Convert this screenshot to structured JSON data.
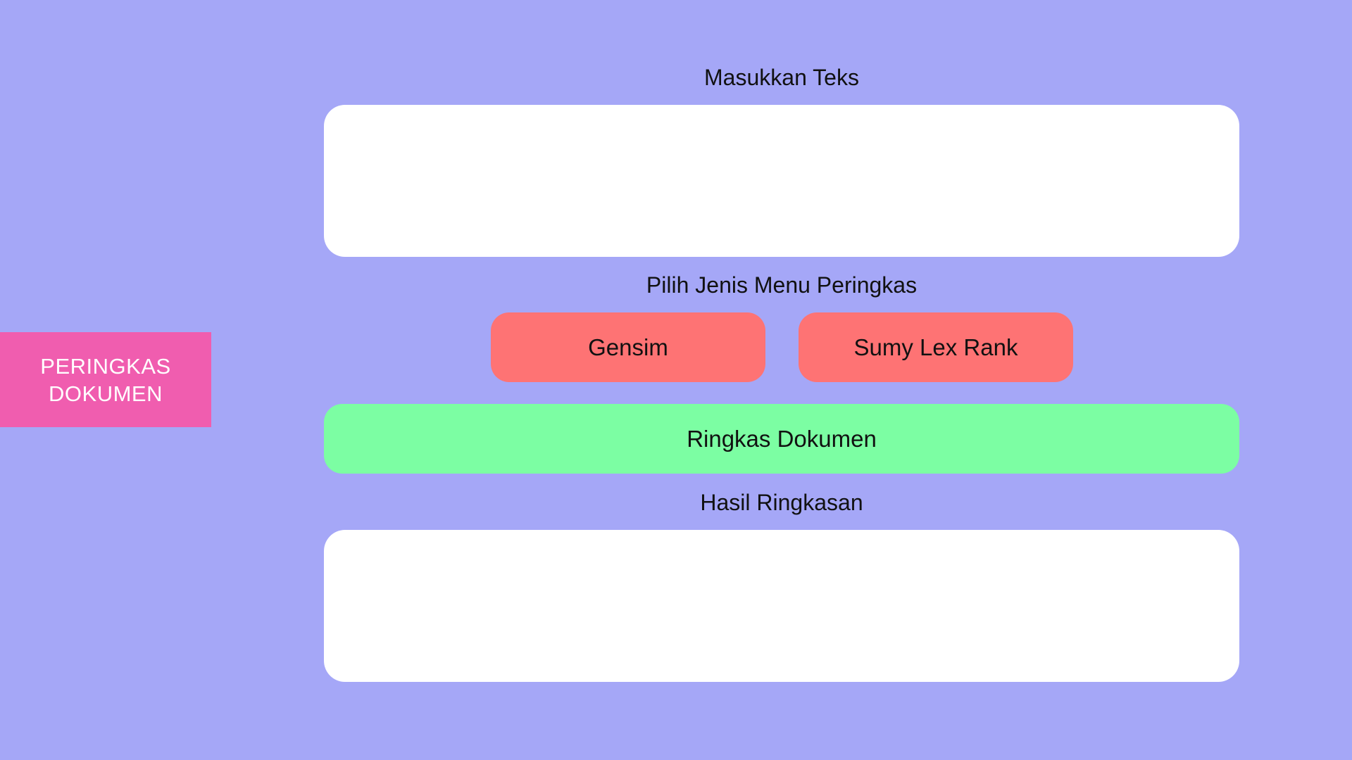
{
  "brand": {
    "line1": "PERINGKAS",
    "line2": "DOKUMEN"
  },
  "input_section": {
    "label": "Masukkan Teks",
    "value": ""
  },
  "method_section": {
    "label": "Pilih Jenis Menu Peringkas",
    "options": [
      {
        "label": "Gensim"
      },
      {
        "label": "Sumy Lex Rank"
      }
    ]
  },
  "actions": {
    "summarize_label": "Ringkas Dokumen"
  },
  "result_section": {
    "label": "Hasil Ringkasan",
    "value": ""
  },
  "colors": {
    "background": "#a5a7f7",
    "brand_block": "#f05daf",
    "method_button": "#fe7374",
    "summarize_button": "#7cfea3",
    "text_box": "#ffffff"
  }
}
